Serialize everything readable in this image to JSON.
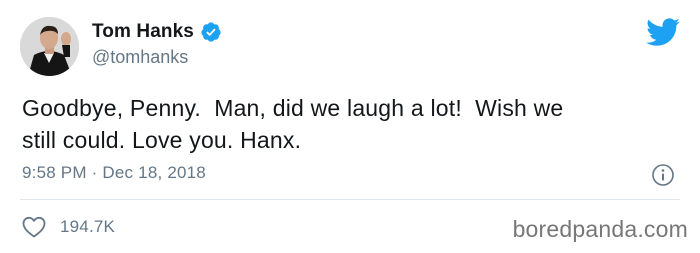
{
  "tweet": {
    "author": {
      "display_name": "Tom Hanks",
      "handle": "@tomhanks",
      "verified": true,
      "avatar_icon": "profile-photo"
    },
    "text": "Goodbye, Penny.  Man, did we laugh a lot!  Wish we\nstill could. Love you. Hanx.",
    "timestamp": "9:58 PM · Dec 18, 2018",
    "likes": "194.7K",
    "icons": {
      "brand": "twitter-bird-icon",
      "verified": "verified-badge-icon",
      "info": "info-icon",
      "like": "heart-icon"
    }
  },
  "watermark": "boredpanda.com",
  "colors": {
    "twitter_blue": "#1da1f2",
    "text_primary": "#14171a",
    "text_secondary": "#657786",
    "divider": "#e1e8ed",
    "watermark": "#777777"
  }
}
